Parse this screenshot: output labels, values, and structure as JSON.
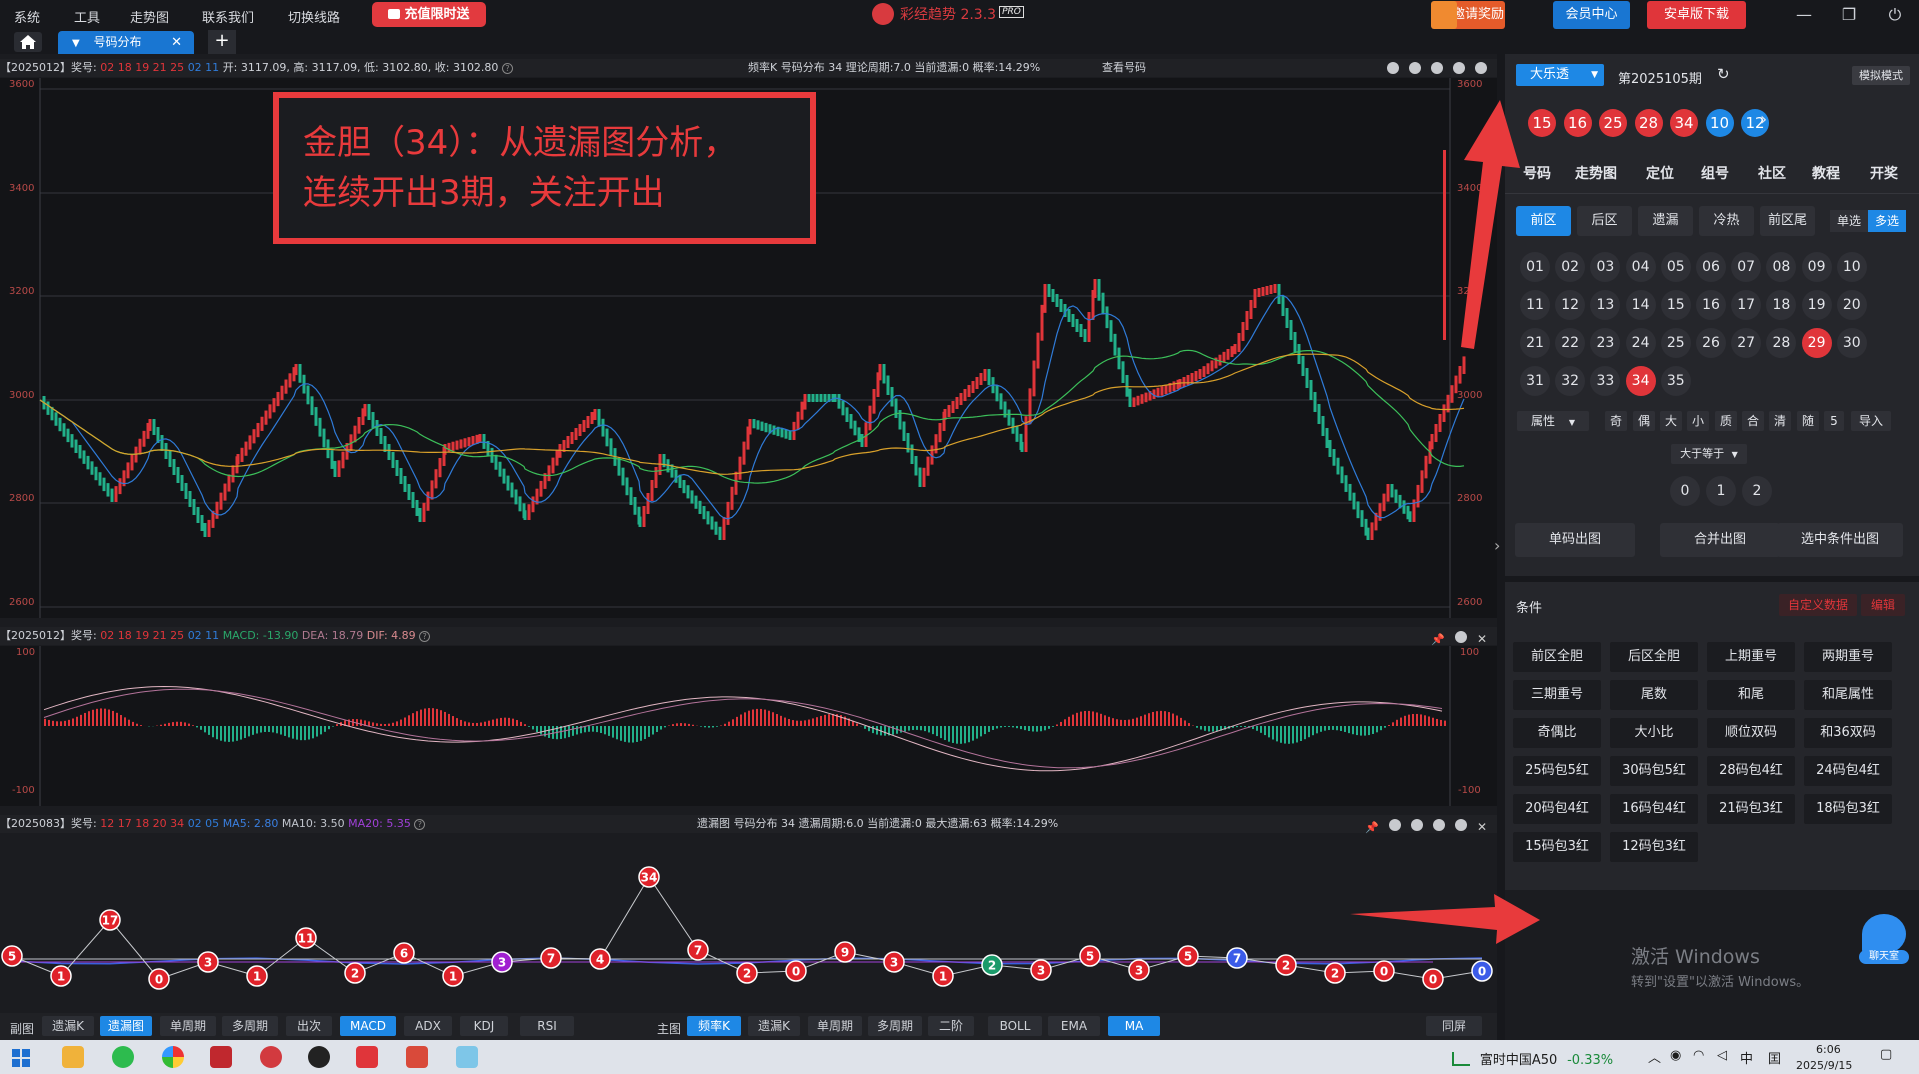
{
  "titlebar": {
    "menu": [
      "系统",
      "工具",
      "走势图",
      "联系我们",
      "切换线路"
    ],
    "promo_label": "充值限时送",
    "app_title": "彩经趋势 2.3.3",
    "app_badge": "PRO",
    "invite_label": "邀请奖励",
    "member_label": "会员中心",
    "android_label": "安卓版下载",
    "win_minimize": "—",
    "win_restore": "❐",
    "win_close": "⏻"
  },
  "tabs": {
    "active_label": "号码分布",
    "close": "✕",
    "add": "+"
  },
  "kline_panel": {
    "issue": "【2025012】奖号:",
    "red_nums": "02 18 19 21 25",
    "blue_nums": "02 11",
    "ohlc": "开: 3117.09, 高: 3117.09, 低: 3102.80, 收: 3102.80",
    "stats": "频率K  号码分布  34     理论周期:7.0  当前遗漏:0  概率:14.29%",
    "view_numbers": "查看号码",
    "y_ticks": [
      "3600",
      "3400",
      "3200",
      "3000",
      "2800",
      "2600"
    ]
  },
  "annotation": {
    "line1": "金胆（34）：从遗漏图分析，",
    "line2": "连续开出3期，关注开出"
  },
  "macd_panel": {
    "issue": "【2025012】奖号:",
    "red_nums": "02 18 19 21 25",
    "blue_nums": "02 11",
    "macd": "MACD: -13.90",
    "dea": "DEA: 18.79",
    "dif": "DIF: 4.89",
    "y_ticks": [
      "100",
      "-100"
    ]
  },
  "omit_panel": {
    "issue": "【2025083】奖号:",
    "red_nums": "12 17 18 20 34",
    "blue_nums": "02 05",
    "ma5": "MA5: 2.80",
    "ma10": "MA10: 3.50",
    "ma20": "MA20: 5.35",
    "stats": "遗漏图  号码分布  34     遗漏周期:6.0  当前遗漏:0  最大遗漏:63  概率:14.29%"
  },
  "omit_points": [
    {
      "v": "5",
      "c": "#e0222a"
    },
    {
      "v": "1",
      "c": "#e0222a"
    },
    {
      "v": "17",
      "c": "#e0222a"
    },
    {
      "v": "0",
      "c": "#e0222a"
    },
    {
      "v": "3",
      "c": "#e0222a"
    },
    {
      "v": "1",
      "c": "#e0222a"
    },
    {
      "v": "11",
      "c": "#e0222a"
    },
    {
      "v": "2",
      "c": "#e0222a"
    },
    {
      "v": "6",
      "c": "#e0222a"
    },
    {
      "v": "1",
      "c": "#e0222a"
    },
    {
      "v": "3",
      "c": "#a020d0"
    },
    {
      "v": "7",
      "c": "#e0222a"
    },
    {
      "v": "4",
      "c": "#e0222a"
    },
    {
      "v": "34",
      "c": "#e0222a"
    },
    {
      "v": "7",
      "c": "#e0222a"
    },
    {
      "v": "2",
      "c": "#e0222a"
    },
    {
      "v": "0",
      "c": "#e0222a"
    },
    {
      "v": "9",
      "c": "#e0222a"
    },
    {
      "v": "3",
      "c": "#e0222a"
    },
    {
      "v": "1",
      "c": "#e0222a"
    },
    {
      "v": "2",
      "c": "#1a9a6a"
    },
    {
      "v": "3",
      "c": "#e0222a"
    },
    {
      "v": "5",
      "c": "#e0222a"
    },
    {
      "v": "3",
      "c": "#e0222a"
    },
    {
      "v": "5",
      "c": "#e0222a"
    },
    {
      "v": "7",
      "c": "#3b5be8"
    },
    {
      "v": "2",
      "c": "#e0222a"
    },
    {
      "v": "2",
      "c": "#e0222a"
    },
    {
      "v": "0",
      "c": "#e0222a"
    },
    {
      "v": "0",
      "c": "#e0222a"
    },
    {
      "v": "0",
      "c": "#3b5be8"
    }
  ],
  "bottombar": {
    "sub_label": "副图",
    "sub_buttons": [
      "遗漏K",
      "遗漏图",
      "单周期",
      "多周期",
      "出次",
      "MACD",
      "ADX",
      "KDJ",
      "RSI"
    ],
    "main_label": "主图",
    "main_buttons": [
      "频率K",
      "遗漏K",
      "单周期",
      "多周期",
      "二阶",
      "BOLL",
      "EMA",
      "MA"
    ],
    "sync_label": "同屏"
  },
  "right": {
    "lottery_select": "大乐透",
    "issue": "第2025105期",
    "mode": "模拟模式",
    "balls": [
      {
        "n": "15",
        "c": "#e0353a"
      },
      {
        "n": "16",
        "c": "#e0353a"
      },
      {
        "n": "25",
        "c": "#e0353a"
      },
      {
        "n": "28",
        "c": "#e0353a"
      },
      {
        "n": "34",
        "c": "#e0353a"
      },
      {
        "n": "10",
        "c": "#1e88e5"
      },
      {
        "n": "12",
        "c": "#1e88e5"
      }
    ],
    "nav_tabs": [
      "号码",
      "走势图",
      "定位",
      "组号",
      "社区",
      "教程",
      "开奖"
    ],
    "seg_buttons": [
      "前区",
      "后区",
      "遗漏",
      "冷热",
      "前区尾"
    ],
    "single_label": "单选",
    "multi_label": "多选",
    "numbers": [
      "01",
      "02",
      "03",
      "04",
      "05",
      "06",
      "07",
      "08",
      "09",
      "10",
      "11",
      "12",
      "13",
      "14",
      "15",
      "16",
      "17",
      "18",
      "19",
      "20",
      "21",
      "22",
      "23",
      "24",
      "25",
      "26",
      "27",
      "28",
      "29",
      "30",
      "31",
      "32",
      "33",
      "34",
      "35"
    ],
    "selected_numbers": [
      "29",
      "34"
    ],
    "attr_select": "属性",
    "attr_buttons": [
      "奇",
      "偶",
      "大",
      "小",
      "质",
      "合",
      "清",
      "随",
      "5",
      "导入"
    ],
    "cmp_select": "大于等于",
    "count_options": [
      "0",
      "1",
      "2"
    ],
    "actions": [
      "单码出图",
      "合并出图",
      "选中条件出图"
    ],
    "conditions_label": "条件",
    "custom_data": "自定义数据",
    "edit": "编辑",
    "conditions": [
      "前区全胆",
      "后区全胆",
      "上期重号",
      "两期重号",
      "三期重号",
      "尾数",
      "和尾",
      "和尾属性",
      "奇偶比",
      "大小比",
      "顺位双码",
      "和36双码",
      "25码包5红",
      "30码包5红",
      "28码包4红",
      "24码包4红",
      "20码包4红",
      "16码包4红",
      "21码包3红",
      "18码包3红",
      "15码包3红",
      "12码包3红"
    ],
    "watermark_title": "激活 Windows",
    "watermark_sub": "转到\"设置\"以激活 Windows。",
    "chat_label": "聊天室"
  },
  "taskbar": {
    "stock_name": "富时中国A50",
    "stock_change": "-0.33%",
    "ime": "中",
    "ime2": "囯",
    "time": "6:06",
    "date": "2025/9/15"
  }
}
